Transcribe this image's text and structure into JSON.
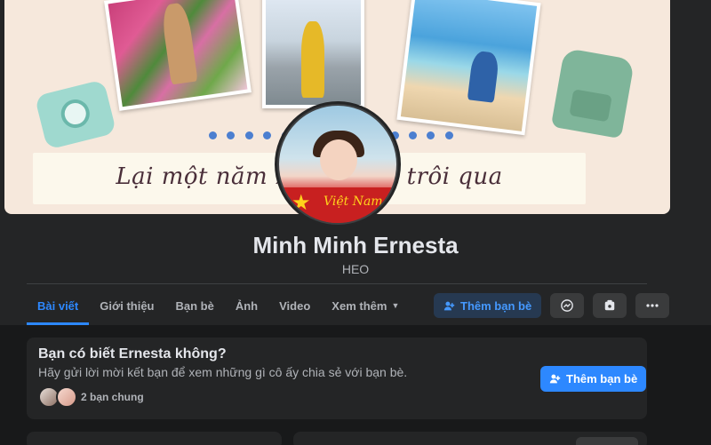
{
  "cover": {
    "banner_text": "Lại một năm xưa đi sắp trôi qua",
    "pagination_dots": 14
  },
  "avatar": {
    "badge_text": "Việt Nam"
  },
  "profile": {
    "name": "Minh Minh Ernesta",
    "nickname": "HEO"
  },
  "tabs": [
    {
      "label": "Bài viết",
      "active": true
    },
    {
      "label": "Giới thiệu"
    },
    {
      "label": "Bạn bè"
    },
    {
      "label": "Ảnh"
    },
    {
      "label": "Video"
    },
    {
      "label": "Xem thêm"
    }
  ],
  "actions": {
    "add_friend_label": "Thêm bạn bè",
    "messenger_icon": "messenger-icon",
    "save_icon": "save-icon",
    "more_icon": "more-icon"
  },
  "suggest_card": {
    "title": "Bạn có biết Ernesta không?",
    "subtitle": "Hãy gửi lời mời kết bạn để xem những gì cô ấy chia sẻ với bạn bè.",
    "mutual_friends": "2 bạn chung",
    "add_friend_label": "Thêm bạn bè"
  },
  "colors": {
    "accent": "#2d88ff",
    "background": "#18191a",
    "surface": "#242526"
  }
}
